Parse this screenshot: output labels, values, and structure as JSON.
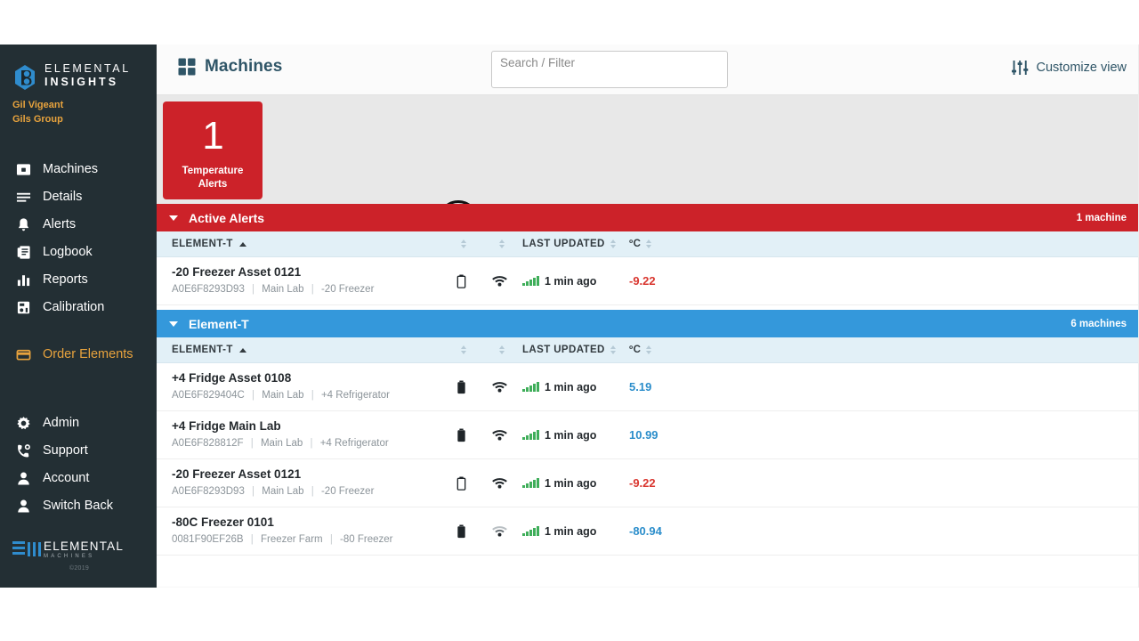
{
  "sidebar": {
    "brand": {
      "line1": "ELEMENTAL",
      "line2": "INSIGHTS",
      "user_name": "Gil Vigeant",
      "user_group": "Gils Group"
    },
    "nav_primary": [
      {
        "label": "Machines",
        "icon": "machines-icon"
      },
      {
        "label": "Details",
        "icon": "details-icon"
      },
      {
        "label": "Alerts",
        "icon": "bell-icon"
      },
      {
        "label": "Logbook",
        "icon": "logbook-icon"
      },
      {
        "label": "Reports",
        "icon": "reports-icon"
      },
      {
        "label": "Calibration",
        "icon": "calibration-icon"
      }
    ],
    "nav_accent": [
      {
        "label": "Order Elements",
        "icon": "order-elements-icon"
      }
    ],
    "nav_secondary": [
      {
        "label": "Admin",
        "icon": "gear-icon"
      },
      {
        "label": "Support",
        "icon": "support-icon"
      },
      {
        "label": "Account",
        "icon": "user-icon"
      },
      {
        "label": "Switch Back",
        "icon": "user-icon"
      }
    ],
    "footer": {
      "word": "ELEMENTAL",
      "word_sub": "MACHINES",
      "copyright": "©2019"
    }
  },
  "topbar": {
    "title": "Machines",
    "title_icon": "grid-icon",
    "search_placeholder": "Search / Filter",
    "search_value": "",
    "customize_label": "Customize view",
    "customize_icon": "sliders-icon"
  },
  "kpi": {
    "count": "1",
    "label_line1": "Temperature",
    "label_line2": "Alerts",
    "color": "#cc2229"
  },
  "columns": {
    "name": "ELEMENT-T",
    "last_updated": "LAST UPDATED",
    "temp": "ºC"
  },
  "sections": [
    {
      "title": "Active Alerts",
      "count": "1 machine",
      "color": "#cc2229",
      "rows": [
        {
          "name": "-20 Freezer Asset 0121",
          "serial": "A0E6F8293D93",
          "location": "Main Lab",
          "type": "-20 Freezer",
          "battery": "empty",
          "wifi": "on",
          "updated": "1 min ago",
          "temp": "-9.22",
          "temp_state": "alert"
        }
      ]
    },
    {
      "title": "Element-T",
      "count": "6 machines",
      "color": "#3498db",
      "rows": [
        {
          "name": "+4 Fridge Asset 0108",
          "serial": "A0E6F829404C",
          "location": "Main Lab",
          "type": "+4 Refrigerator",
          "battery": "full",
          "wifi": "on",
          "updated": "1 min ago",
          "temp": "5.19",
          "temp_state": "normal"
        },
        {
          "name": "+4 Fridge Main Lab",
          "serial": "A0E6F828812F",
          "location": "Main Lab",
          "type": "+4 Refrigerator",
          "battery": "full",
          "wifi": "on",
          "updated": "1 min ago",
          "temp": "10.99",
          "temp_state": "normal"
        },
        {
          "name": "-20 Freezer Asset 0121",
          "serial": "A0E6F8293D93",
          "location": "Main Lab",
          "type": "-20 Freezer",
          "battery": "empty",
          "wifi": "on",
          "updated": "1 min ago",
          "temp": "-9.22",
          "temp_state": "alert"
        },
        {
          "name": "-80C Freezer 0101",
          "serial": "0081F90EF26B",
          "location": "Freezer Farm",
          "type": "-80 Freezer",
          "battery": "full",
          "wifi": "weak",
          "updated": "1 min ago",
          "temp": "-80.94",
          "temp_state": "normal"
        }
      ]
    }
  ],
  "colors": {
    "sidebar_bg": "#232f34",
    "accent_orange": "#e8a33d",
    "alert_red": "#cc2229",
    "section_blue": "#3498db",
    "temp_blue": "#2c8ecb",
    "temp_red": "#d9362f",
    "title_blue": "#2f5567"
  }
}
